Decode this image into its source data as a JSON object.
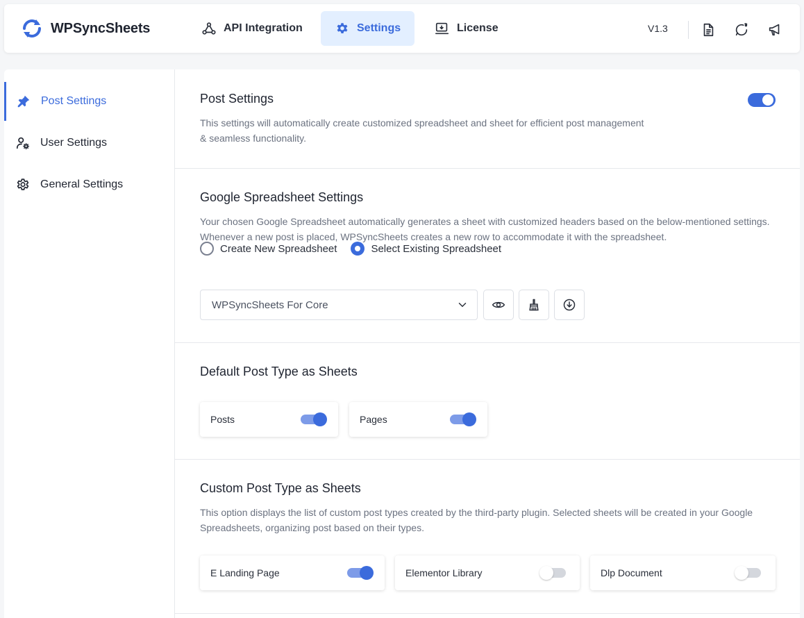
{
  "app": {
    "name": "WPSyncSheets",
    "version": "V1.3"
  },
  "nav": {
    "tabs": [
      {
        "label": "API Integration",
        "icon": "webhook-icon"
      },
      {
        "label": "Settings",
        "icon": "gear-icon",
        "active": true
      },
      {
        "label": "License",
        "icon": "license-monitor-icon"
      }
    ],
    "actions": [
      "document-icon",
      "chat-bubble-icon",
      "megaphone-icon"
    ]
  },
  "sidebar": {
    "items": [
      {
        "label": "Post Settings",
        "icon": "pin-icon",
        "active": true
      },
      {
        "label": "User Settings",
        "icon": "user-gear-icon"
      },
      {
        "label": "General Settings",
        "icon": "gear-icon"
      }
    ]
  },
  "post_settings": {
    "title": "Post Settings",
    "description": "This settings will automatically create customized spreadsheet and sheet for efficient post management & seamless functionality.",
    "enabled": true
  },
  "spreadsheet": {
    "title": "Google Spreadsheet Settings",
    "description": "Your chosen Google Spreadsheet automatically generates a sheet with customized headers based on the below-mentioned settings. Whenever a new post is placed, WPSyncSheets creates a new row to accommodate it with the spreadsheet.",
    "options": [
      {
        "label": "Create New Spreadsheet",
        "checked": false
      },
      {
        "label": "Select Existing Spreadsheet",
        "checked": true
      }
    ],
    "selected": "WPSyncSheets For Core",
    "buttons": [
      "eye-icon",
      "broom-icon",
      "download-icon"
    ]
  },
  "default_post_types": {
    "title": "Default Post Type as Sheets",
    "items": [
      {
        "label": "Posts",
        "enabled": true
      },
      {
        "label": "Pages",
        "enabled": true
      }
    ]
  },
  "custom_post_types": {
    "title": "Custom Post Type as Sheets",
    "description": "This option displays the list of custom post types created by the third-party plugin. Selected sheets will be created in your Google Spreadsheets, organizing post based on their types.",
    "items": [
      {
        "label": "E Landing Page",
        "enabled": true
      },
      {
        "label": "Elementor Library",
        "enabled": false
      },
      {
        "label": "Dlp Document",
        "enabled": false
      }
    ]
  },
  "colors": {
    "accent": "#3b6bdc",
    "accent_light": "#e3efff",
    "toggle_track": "#7d9be8"
  }
}
